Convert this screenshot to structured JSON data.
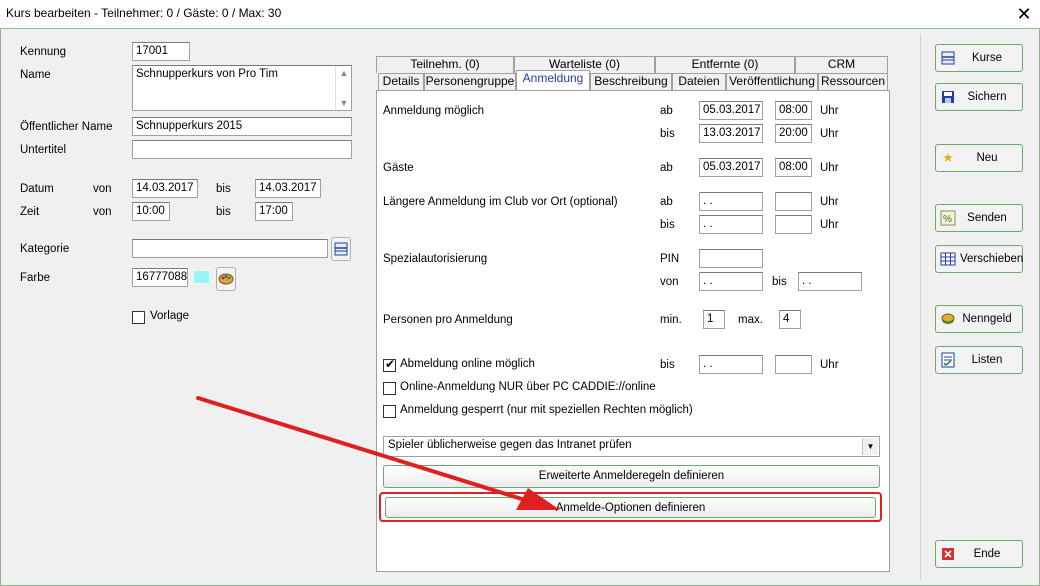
{
  "window": {
    "title": "Kurs bearbeiten - Teilnehmer: 0 / Gäste: 0 / Max: 30",
    "close": "✕"
  },
  "left": {
    "kennung_label": "Kennung",
    "kennung_value": "17001",
    "name_label": "Name",
    "name_value": "Schnupperkurs von Pro Tim",
    "oeff_label": "Öffentlicher Name",
    "oeff_value": "Schnupperkurs 2015",
    "untertitel_label": "Untertitel",
    "untertitel_value": "",
    "datum_label": "Datum",
    "zeit_label": "Zeit",
    "von": "von",
    "bis": "bis",
    "datum_von": "14.03.2017",
    "datum_bis": "14.03.2017",
    "zeit_von": "10:00",
    "zeit_bis": "17:00",
    "kategorie_label": "Kategorie",
    "kategorie_value": "",
    "farbe_label": "Farbe",
    "farbe_value": "16777088",
    "farbe_color": "#99f5f8",
    "vorlage_label": "Vorlage"
  },
  "tabs": {
    "top": [
      "Teilnehm. (0)",
      "Warteliste (0)",
      "Entfernte (0)",
      "CRM"
    ],
    "bottom": [
      "Details",
      "Personengruppe",
      "Anmeldung",
      "Beschreibung",
      "Dateien",
      "Veröffentlichung",
      "Ressourcen"
    ],
    "active": "Anmeldung"
  },
  "anmeldung": {
    "moeglich_label": "Anmeldung möglich",
    "ab": "ab",
    "bis": "bis",
    "uhr": "Uhr",
    "von": "von",
    "moeglich_ab_date": "05.03.2017",
    "moeglich_ab_time": "08:00",
    "moeglich_bis_date": "13.03.2017",
    "moeglich_bis_time": "20:00",
    "gaeste_label": "Gäste",
    "gaeste_ab_date": "05.03.2017",
    "gaeste_ab_time": "08:00",
    "laenger_label": "Längere Anmeldung im Club vor Ort (optional)",
    "empty_date": " .  .",
    "spezial_label": "Spezialautorisierung",
    "pin_label": "PIN",
    "personen_label": "Personen pro Anmeldung",
    "min_label": "min.",
    "max_label": "max.",
    "min_value": "1",
    "max_value": "4",
    "abmeldung_label": "Abmeldung online möglich",
    "online_only_label": "Online-Anmeldung NUR über PC CADDIE://online",
    "gesperrt_label": "Anmeldung gesperrt (nur mit speziellen Rechten möglich)",
    "dropdown_value": "Spieler üblicherweise gegen das Intranet prüfen",
    "btn_erweitert": "Erweiterte Anmelderegeln definieren",
    "btn_optionen": "Anmelde-Optionen definieren"
  },
  "sidebar": {
    "kurse": "Kurse",
    "sichern": "Sichern",
    "neu": "Neu",
    "senden": "Senden",
    "verschieben": "Verschieben",
    "nenngeld": "Nenngeld",
    "listen": "Listen",
    "ende": "Ende"
  },
  "colors": {
    "accent_green": "#6fa66f",
    "annotation_red": "#e02020",
    "active_tab_text": "#1f3fa8"
  }
}
